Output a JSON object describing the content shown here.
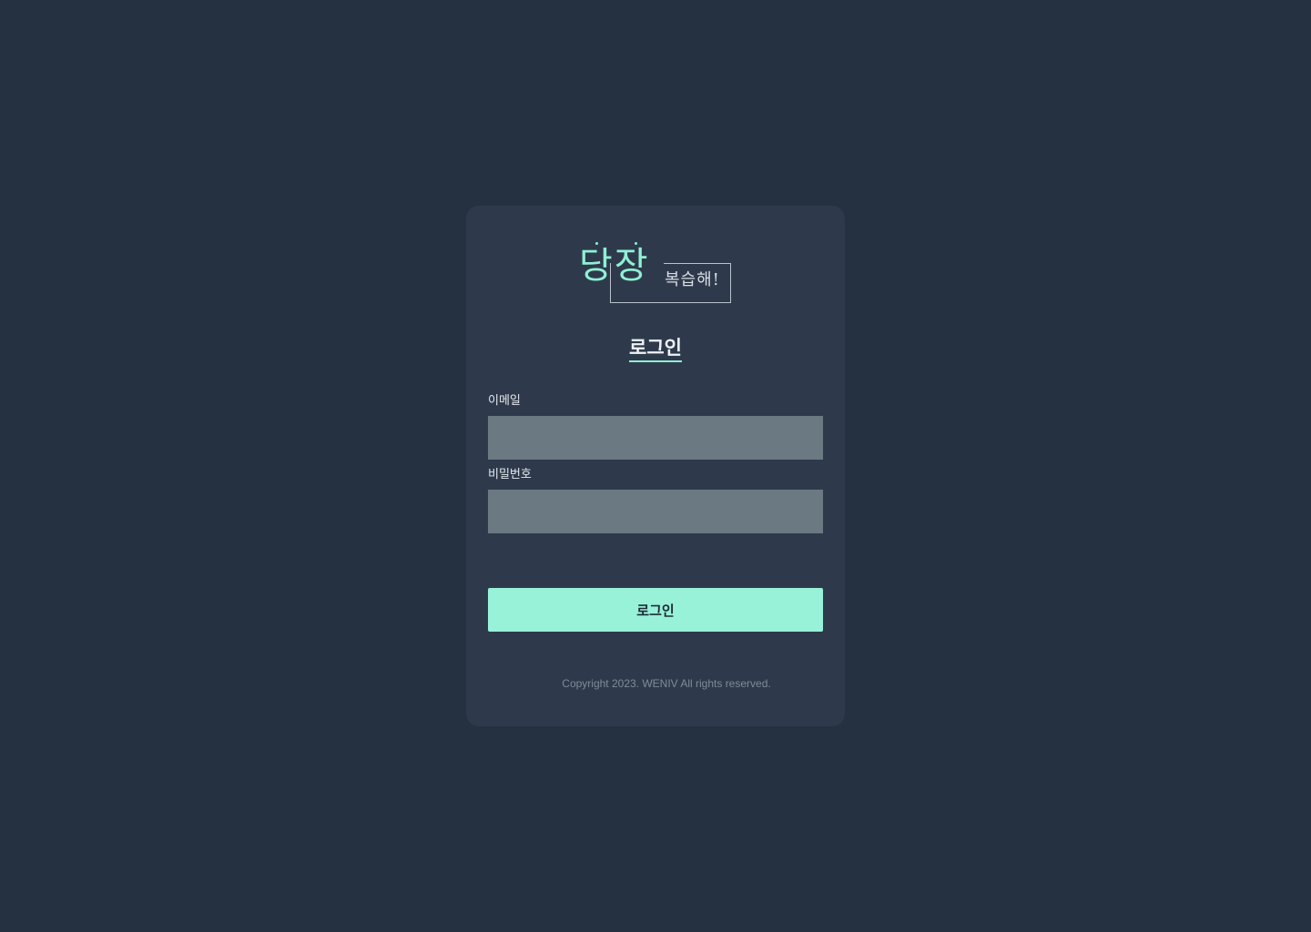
{
  "logo": {
    "main": "당장",
    "sub": "복습해!"
  },
  "login": {
    "title": "로그인",
    "email_label": "이메일",
    "email_value": "",
    "password_label": "비밀번호",
    "password_value": "",
    "button_label": "로그인"
  },
  "footer": {
    "copyright": "Copyright 2023. WENIV All rights reserved."
  },
  "colors": {
    "background": "#253141",
    "card": "#2e3a4c",
    "accent": "#8ff0d3",
    "input": "#6b7a82",
    "button": "#98f2d8"
  }
}
